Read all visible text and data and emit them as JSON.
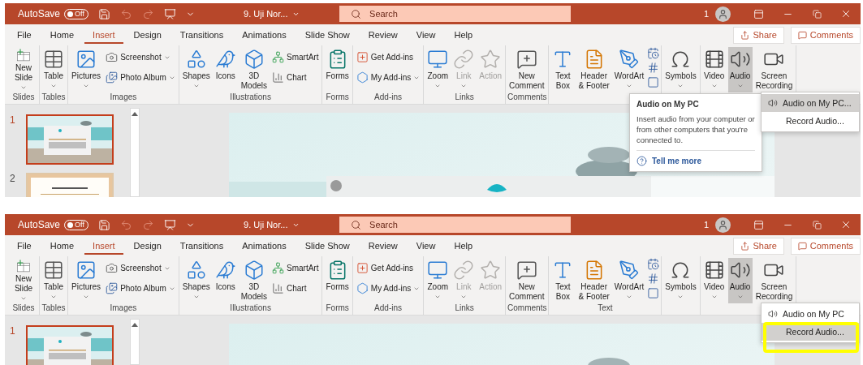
{
  "screens": [
    {
      "title_bar": {
        "autosave": {
          "label": "AutoSave",
          "toggle_text": "Off",
          "on": false
        },
        "document_title": "9. Uji Nor...",
        "search": {
          "placeholder": "Search"
        },
        "notification_count": "1"
      },
      "tabs": [
        {
          "label": "File",
          "selected": false
        },
        {
          "label": "Home",
          "selected": false
        },
        {
          "label": "Insert",
          "selected": true
        },
        {
          "label": "Design",
          "selected": false
        },
        {
          "label": "Transitions",
          "selected": false
        },
        {
          "label": "Animations",
          "selected": false
        },
        {
          "label": "Slide Show",
          "selected": false
        },
        {
          "label": "Review",
          "selected": false
        },
        {
          "label": "View",
          "selected": false
        },
        {
          "label": "Help",
          "selected": false
        }
      ],
      "share_button": "Share",
      "comments_button": "Comments",
      "ribbon_groups": [
        {
          "label": "Slides",
          "items": [
            {
              "kind": "large",
              "label": "New\nSlide",
              "dropdown": true,
              "disabled": false,
              "pressed": false
            }
          ]
        },
        {
          "label": "Tables",
          "items": [
            {
              "kind": "large",
              "label": "Table",
              "dropdown": true,
              "disabled": false,
              "pressed": false
            }
          ]
        },
        {
          "label": "Images",
          "items": [
            {
              "kind": "large",
              "label": "Pictures",
              "dropdown": true,
              "disabled": false,
              "pressed": false
            },
            {
              "kind": "small",
              "label": "Screenshot",
              "dropdown": true,
              "disabled": false,
              "pressed": false
            },
            {
              "kind": "small",
              "label": "Photo Album",
              "dropdown": true,
              "disabled": false,
              "pressed": false
            }
          ]
        },
        {
          "label": "Illustrations",
          "items": [
            {
              "kind": "large",
              "label": "Shapes",
              "dropdown": true,
              "disabled": false,
              "pressed": false
            },
            {
              "kind": "large",
              "label": "Icons",
              "dropdown": false,
              "disabled": false,
              "pressed": false
            },
            {
              "kind": "large",
              "label": "3D\nModels",
              "dropdown": false,
              "disabled": false,
              "pressed": false
            },
            {
              "kind": "small",
              "label": "SmartArt",
              "dropdown": false,
              "disabled": false,
              "pressed": false
            },
            {
              "kind": "small",
              "label": "Chart",
              "dropdown": false,
              "disabled": false,
              "pressed": false
            }
          ]
        },
        {
          "label": "Forms",
          "items": [
            {
              "kind": "large",
              "label": "Forms",
              "dropdown": false,
              "disabled": false,
              "pressed": false
            }
          ]
        },
        {
          "label": "Add-ins",
          "items": [
            {
              "kind": "small",
              "label": "Get Add-ins",
              "dropdown": false,
              "disabled": false,
              "pressed": false
            },
            {
              "kind": "small",
              "label": "My Add-ins",
              "dropdown": true,
              "disabled": false,
              "pressed": false
            }
          ]
        },
        {
          "label": "Links",
          "items": [
            {
              "kind": "large",
              "label": "Zoom",
              "dropdown": true,
              "disabled": false,
              "pressed": false
            },
            {
              "kind": "large",
              "label": "Link",
              "dropdown": true,
              "disabled": true,
              "pressed": false
            },
            {
              "kind": "large",
              "label": "Action",
              "dropdown": false,
              "disabled": true,
              "pressed": false
            }
          ]
        },
        {
          "label": "Comments",
          "items": [
            {
              "kind": "large",
              "label": "New\nComment",
              "dropdown": false,
              "disabled": false,
              "pressed": false
            }
          ]
        },
        {
          "items": [
            {
              "kind": "large",
              "label": "Text\nBox",
              "dropdown": false,
              "disabled": false,
              "pressed": false
            },
            {
              "kind": "large",
              "label": "Header\n& Footer",
              "dropdown": false,
              "disabled": false,
              "pressed": false
            },
            {
              "kind": "large",
              "label": "WordArt",
              "dropdown": true,
              "disabled": false,
              "pressed": false
            },
            {
              "kind": "icon",
              "dropdown": false,
              "disabled": false,
              "pressed": false
            },
            {
              "kind": "icon",
              "dropdown": false,
              "disabled": false,
              "pressed": false
            },
            {
              "kind": "icon",
              "dropdown": false,
              "disabled": false,
              "pressed": false
            }
          ]
        },
        {
          "items": [
            {
              "kind": "large",
              "label": "Symbols",
              "dropdown": true,
              "disabled": false,
              "pressed": false
            }
          ]
        },
        {
          "items": [
            {
              "kind": "large",
              "label": "Video",
              "dropdown": true,
              "disabled": false,
              "pressed": false
            },
            {
              "kind": "large",
              "label": "Audio",
              "dropdown": true,
              "disabled": false,
              "pressed": true
            },
            {
              "kind": "large",
              "label": "Screen\nRecording",
              "dropdown": false,
              "disabled": false,
              "pressed": false
            }
          ]
        }
      ],
      "slides": [
        {
          "number": "1",
          "selected": true
        },
        {
          "number": "2",
          "selected": false
        }
      ],
      "tooltip": {
        "title": "Audio on My PC",
        "text": "Insert audio from your computer or from other computers that you're connected to.",
        "link": "Tell me more"
      },
      "audio_menu": [
        {
          "label": "Audio on My PC...",
          "icon": true,
          "selected": true,
          "circled": false
        },
        {
          "label": "Record Audio...",
          "icon": false,
          "selected": false,
          "circled": false
        }
      ]
    },
    {
      "title_bar": {
        "autosave": {
          "label": "AutoSave",
          "toggle_text": "Off",
          "on": false
        },
        "document_title": "9. Uji Nor...",
        "search": {
          "placeholder": "Search"
        },
        "notification_count": "1"
      },
      "tabs": [
        {
          "label": "File",
          "selected": false
        },
        {
          "label": "Home",
          "selected": false
        },
        {
          "label": "Insert",
          "selected": true
        },
        {
          "label": "Design",
          "selected": false
        },
        {
          "label": "Transitions",
          "selected": false
        },
        {
          "label": "Animations",
          "selected": false
        },
        {
          "label": "Slide Show",
          "selected": false
        },
        {
          "label": "Review",
          "selected": false
        },
        {
          "label": "View",
          "selected": false
        },
        {
          "label": "Help",
          "selected": false
        }
      ],
      "share_button": "Share",
      "comments_button": "Comments",
      "ribbon_groups": [
        {
          "label": "Slides",
          "items": [
            {
              "kind": "large",
              "label": "New\nSlide",
              "dropdown": true,
              "disabled": false,
              "pressed": false
            }
          ]
        },
        {
          "label": "Tables",
          "items": [
            {
              "kind": "large",
              "label": "Table",
              "dropdown": true,
              "disabled": false,
              "pressed": false
            }
          ]
        },
        {
          "label": "Images",
          "items": [
            {
              "kind": "large",
              "label": "Pictures",
              "dropdown": true,
              "disabled": false,
              "pressed": false
            },
            {
              "kind": "small",
              "label": "Screenshot",
              "dropdown": true,
              "disabled": false,
              "pressed": false
            },
            {
              "kind": "small",
              "label": "Photo Album",
              "dropdown": true,
              "disabled": false,
              "pressed": false
            }
          ]
        },
        {
          "label": "Illustrations",
          "items": [
            {
              "kind": "large",
              "label": "Shapes",
              "dropdown": true,
              "disabled": false,
              "pressed": false
            },
            {
              "kind": "large",
              "label": "Icons",
              "dropdown": false,
              "disabled": false,
              "pressed": false
            },
            {
              "kind": "large",
              "label": "3D\nModels",
              "dropdown": false,
              "disabled": false,
              "pressed": false
            },
            {
              "kind": "small",
              "label": "SmartArt",
              "dropdown": false,
              "disabled": false,
              "pressed": false
            },
            {
              "kind": "small",
              "label": "Chart",
              "dropdown": false,
              "disabled": false,
              "pressed": false
            }
          ]
        },
        {
          "label": "Forms",
          "items": [
            {
              "kind": "large",
              "label": "Forms",
              "dropdown": false,
              "disabled": false,
              "pressed": false
            }
          ]
        },
        {
          "label": "Add-ins",
          "items": [
            {
              "kind": "small",
              "label": "Get Add-ins",
              "dropdown": false,
              "disabled": false,
              "pressed": false
            },
            {
              "kind": "small",
              "label": "My Add-ins",
              "dropdown": true,
              "disabled": false,
              "pressed": false
            }
          ]
        },
        {
          "label": "Links",
          "items": [
            {
              "kind": "large",
              "label": "Zoom",
              "dropdown": true,
              "disabled": false,
              "pressed": false
            },
            {
              "kind": "large",
              "label": "Link",
              "dropdown": true,
              "disabled": true,
              "pressed": false
            },
            {
              "kind": "large",
              "label": "Action",
              "dropdown": false,
              "disabled": true,
              "pressed": false
            }
          ]
        },
        {
          "label": "Comments",
          "items": [
            {
              "kind": "large",
              "label": "New\nComment",
              "dropdown": false,
              "disabled": false,
              "pressed": false
            }
          ]
        },
        {
          "label": "Text",
          "items": [
            {
              "kind": "large",
              "label": "Text\nBox",
              "dropdown": false,
              "disabled": false,
              "pressed": false
            },
            {
              "kind": "large",
              "label": "Header\n& Footer",
              "dropdown": false,
              "disabled": false,
              "pressed": false
            },
            {
              "kind": "large",
              "label": "WordArt",
              "dropdown": true,
              "disabled": false,
              "pressed": false
            },
            {
              "kind": "icon",
              "dropdown": false,
              "disabled": false,
              "pressed": false
            },
            {
              "kind": "icon",
              "dropdown": false,
              "disabled": false,
              "pressed": false
            },
            {
              "kind": "icon",
              "dropdown": false,
              "disabled": false,
              "pressed": false
            }
          ]
        },
        {
          "items": [
            {
              "kind": "large",
              "label": "Symbols",
              "dropdown": true,
              "disabled": false,
              "pressed": false
            }
          ]
        },
        {
          "items": [
            {
              "kind": "large",
              "label": "Video",
              "dropdown": true,
              "disabled": false,
              "pressed": false
            },
            {
              "kind": "large",
              "label": "Audio",
              "dropdown": true,
              "disabled": false,
              "pressed": true
            },
            {
              "kind": "large",
              "label": "Screen\nRecording",
              "dropdown": false,
              "disabled": false,
              "pressed": false
            }
          ]
        }
      ],
      "slides": [
        {
          "number": "1",
          "selected": true
        }
      ],
      "audio_menu": [
        {
          "label": "Audio on My PC",
          "icon": true,
          "selected": false,
          "circled": false
        },
        {
          "label": "Record Audio...",
          "icon": false,
          "selected": true,
          "circled": true
        }
      ]
    }
  ]
}
